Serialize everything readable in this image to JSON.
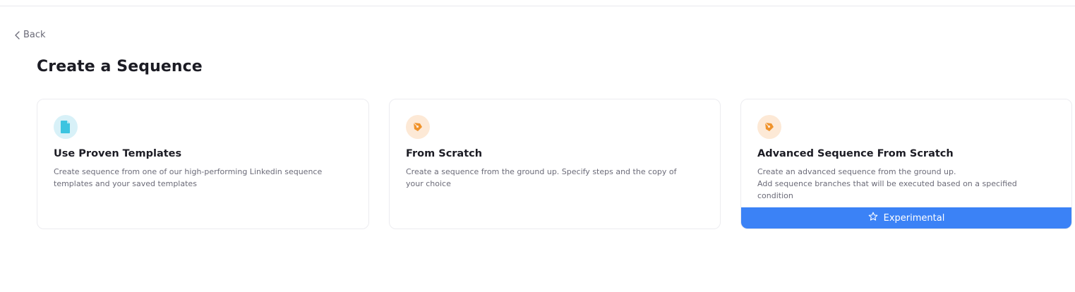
{
  "nav": {
    "back_label": "Back"
  },
  "page": {
    "title": "Create a Sequence"
  },
  "cards": [
    {
      "icon": "document-icon",
      "title": "Use Proven Templates",
      "description_lines": [
        "Create sequence from one of our high-performing Linkedin sequence",
        "templates and your saved templates"
      ]
    },
    {
      "icon": "pen-nib-icon",
      "title": "From Scratch",
      "description_lines": [
        "Create a sequence from the ground up. Specify steps and the copy of",
        "your choice"
      ]
    },
    {
      "icon": "pen-nib-icon",
      "title": "Advanced Sequence From Scratch",
      "description_lines": [
        "Create an advanced sequence from the ground up.",
        "Add sequence branches that will be executed based on a specified",
        "condition"
      ],
      "badge": {
        "icon": "star-icon",
        "label": "Experimental"
      }
    }
  ],
  "colors": {
    "accent_blue": "#3b82f6",
    "icon_blue": "#3cc4e0",
    "icon_orange": "#f0932b",
    "title_text": "#1c1c24",
    "muted_text": "#6b6b78"
  }
}
